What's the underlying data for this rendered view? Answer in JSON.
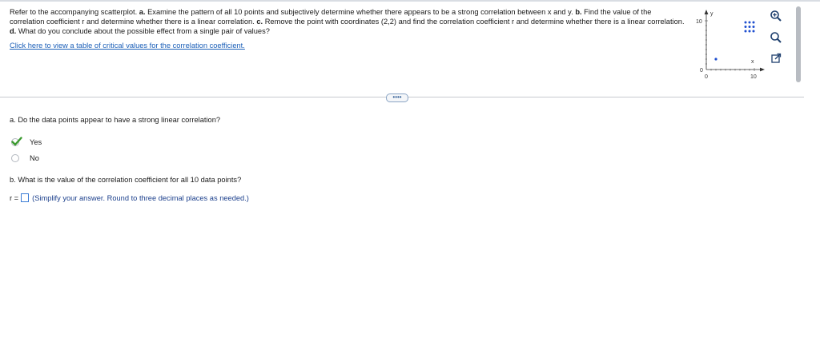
{
  "question": {
    "intro": "Refer to the accompanying scatterplot. ",
    "a_tag": "a.",
    "a_text": " Examine the pattern of all 10 points and subjectively determine whether there appears to be a strong correlation between x and y. ",
    "b_tag": "b.",
    "b_text": " Find the value of the correlation coefficient r and determine whether there is a linear correlation. ",
    "c_tag": "c.",
    "c_text": " Remove the point with coordinates (2,2) and find the correlation coefficient r and determine whether there is a linear correlation. ",
    "d_tag": "d.",
    "d_text": " What do you conclude about the possible effect from a single pair of values?"
  },
  "link_text": "Click here to view a table of critical values for the correlation coefficient.",
  "plot": {
    "y_axis_label": "y",
    "x_axis_label": "x",
    "y_tick_top": "10",
    "y_tick_origin": "0",
    "x_tick_origin": "0",
    "x_tick_right": "10",
    "point_color": "#1f4fcf"
  },
  "more_button": "••••",
  "part_a": {
    "prompt": "a. Do the data points appear to have a strong linear correlation?",
    "options": [
      {
        "label": "Yes",
        "selected": true
      },
      {
        "label": "No",
        "selected": false
      }
    ]
  },
  "part_b": {
    "prompt": "b. What is the value of the correlation coefficient for all 10 data points?",
    "answer_prefix": "r =",
    "answer_value": "",
    "hint": "(Simplify your answer. Round to three decimal places as needed.)"
  },
  "colors": {
    "accent": "#1b5fb8",
    "check": "#3a9a2e",
    "input_border": "#3a7bd5"
  }
}
